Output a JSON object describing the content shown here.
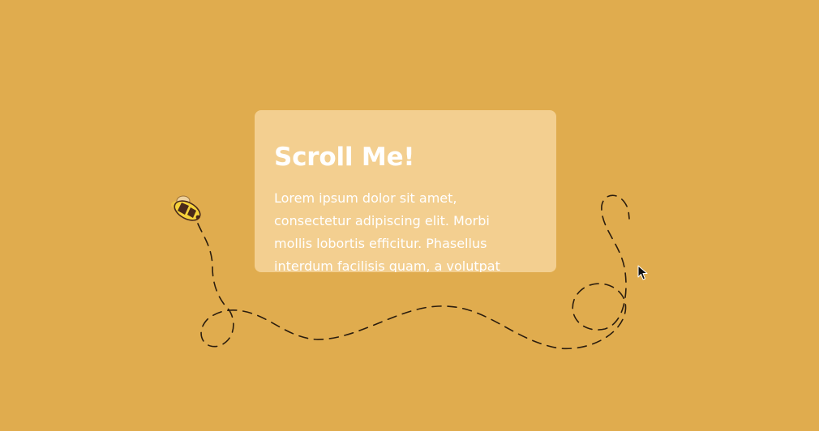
{
  "card": {
    "title": "Scroll Me!",
    "body": "Lorem ipsum dolor sit amet, consectetur adipiscing elit. Morbi mollis lobortis efficitur. Phasellus interdum facilisis quam, a volutpat"
  },
  "icons": {
    "bee": "bee-icon",
    "cursor": "mouse-pointer-icon"
  },
  "colors": {
    "background": "#E0AC4E",
    "card": "#F3CF90",
    "text": "#FFFFFF",
    "path": "#2B1D0E",
    "bee_yellow": "#F6D23A",
    "bee_stripe": "#4A2A1A"
  }
}
